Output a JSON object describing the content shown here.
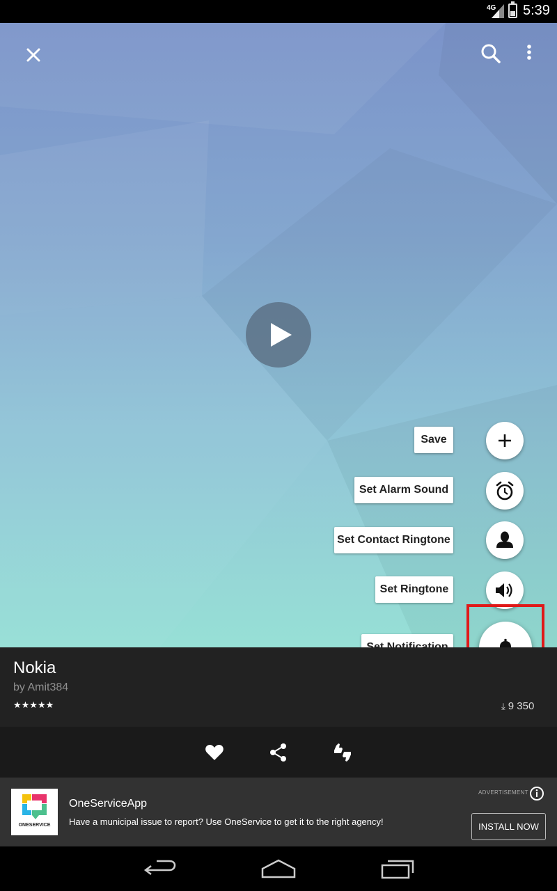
{
  "status_bar": {
    "network": "4G",
    "time": "5:39"
  },
  "toolbar": {
    "close_icon": "close-icon",
    "search_icon": "search-icon",
    "more_icon": "more-vert-icon"
  },
  "player": {
    "play_icon": "play-icon"
  },
  "fab_menu": {
    "items": [
      {
        "label": "Save",
        "icon": "plus-icon"
      },
      {
        "label": "Set Alarm Sound",
        "icon": "alarm-clock-icon"
      },
      {
        "label": "Set Contact Ringtone",
        "icon": "person-icon"
      },
      {
        "label": "Set Ringtone",
        "icon": "speaker-icon"
      }
    ],
    "main": {
      "label": "Set Notification",
      "icon": "bell-icon"
    },
    "highlight_color": "#e01919"
  },
  "ringtone": {
    "title": "Nokia",
    "author": "by Amit384",
    "rating_stars": "★★★★★",
    "download_icon": "download-icon",
    "downloads": "9 350"
  },
  "actions": {
    "icons": [
      "heart-icon",
      "share-icon",
      "thumbs-up-down-icon"
    ]
  },
  "ad": {
    "label": "ADVERTISEMENT",
    "app_name": "OneServiceApp",
    "logo_text": "ONESERVICE",
    "description": "Have a municipal issue to report? Use OneService to get it to the right agency!",
    "install_label": "INSTALL NOW"
  },
  "nav_bar": {
    "icons": [
      "back-icon",
      "home-icon",
      "recents-icon"
    ]
  }
}
